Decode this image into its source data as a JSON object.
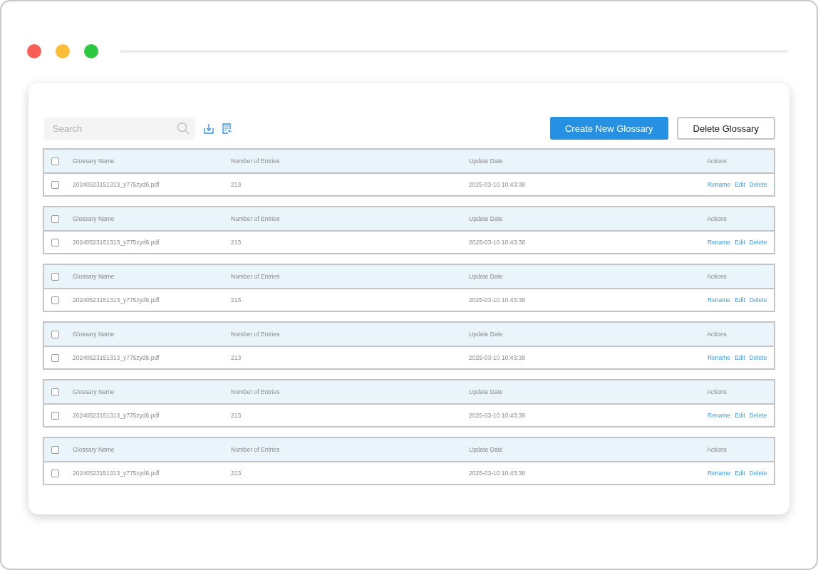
{
  "toolbar": {
    "search": {
      "placeholder": "Search"
    },
    "buttons": [
      {
        "label": "Create New Glossary",
        "kind": "primary"
      },
      {
        "label": "Delete Glossary",
        "kind": "outline"
      }
    ]
  },
  "tables": [
    {
      "columns": [
        "Glossary Name",
        "Number of Entries",
        "Update Date",
        "Actions"
      ],
      "header_checked": false,
      "row": {
        "checked": false,
        "name": "20240523151313_y775zyd6.pdf",
        "entries": "213",
        "date": "2025-03-10 10:43:38",
        "actions": [
          "Rename",
          "Edit",
          "Delete"
        ]
      }
    },
    {
      "columns": [
        "Glossary Name",
        "Number of Entries",
        "Update Date",
        "Actions"
      ],
      "header_checked": false,
      "row": {
        "checked": false,
        "name": "20240523151313_y775zyd6.pdf",
        "entries": "213",
        "date": "2025-03-10 10:43:38",
        "actions": [
          "Rename",
          "Edit",
          "Delete"
        ]
      }
    },
    {
      "columns": [
        "Glossary Name",
        "Number of Entries",
        "Update Date",
        "Actions"
      ],
      "header_checked": false,
      "row": {
        "checked": false,
        "name": "20240523151313_y775zyd6.pdf",
        "entries": "213",
        "date": "2025-03-10 10:43:38",
        "actions": [
          "Rename",
          "Edit",
          "Delete"
        ]
      }
    },
    {
      "columns": [
        "Glossary Name",
        "Number of Entries",
        "Update Date",
        "Actions"
      ],
      "header_checked": false,
      "row": {
        "checked": false,
        "name": "20240523151313_y775zyd6.pdf",
        "entries": "213",
        "date": "2025-03-10 10:43:38",
        "actions": [
          "Rename",
          "Edit",
          "Delete"
        ]
      }
    },
    {
      "columns": [
        "Glossary Name",
        "Number of Entries",
        "Update Date",
        "Actions"
      ],
      "header_checked": false,
      "row": {
        "checked": false,
        "name": "20240523151313_y775zyd6.pdf",
        "entries": "213",
        "date": "2025-03-10 10:43:38",
        "actions": [
          "Rename",
          "Edit",
          "Delete"
        ]
      }
    },
    {
      "columns": [
        "Glossary Name",
        "Number of Entries",
        "Update Date",
        "Actions"
      ],
      "header_checked": false,
      "row": {
        "checked": false,
        "name": "20240523151313_y775zyd6.pdf",
        "entries": "213",
        "date": "2025-03-10 10:43:38",
        "actions": [
          "Rename",
          "Edit",
          "Delete"
        ]
      }
    }
  ]
}
